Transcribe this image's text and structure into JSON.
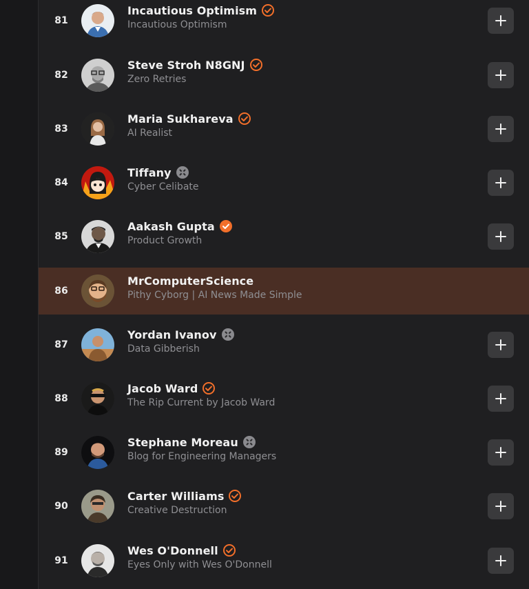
{
  "rows": [
    {
      "rank": "81",
      "name": "Incautious Optimism",
      "subtitle": "Incautious Optimism",
      "badge": "verified-outline",
      "highlighted": false,
      "follow_icon": "plus-icon"
    },
    {
      "rank": "82",
      "name": "Steve Stroh N8GNJ",
      "subtitle": "Zero Retries",
      "badge": "verified-outline",
      "highlighted": false,
      "follow_icon": "plus-icon"
    },
    {
      "rank": "83",
      "name": "Maria Sukhareva",
      "subtitle": "AI Realist",
      "badge": "verified-outline",
      "highlighted": false,
      "follow_icon": "plus-icon"
    },
    {
      "rank": "84",
      "name": "Tiffany",
      "subtitle": "Cyber Celibate",
      "badge": "gray-badge",
      "highlighted": false,
      "follow_icon": "plus-icon"
    },
    {
      "rank": "85",
      "name": "Aakash Gupta",
      "subtitle": "Product Growth",
      "badge": "verified-filled",
      "highlighted": false,
      "follow_icon": "plus-icon"
    },
    {
      "rank": "86",
      "name": "MrComputerScience",
      "subtitle": "Pithy Cyborg | AI News Made Simple",
      "badge": "none",
      "highlighted": true,
      "follow_icon": "none"
    },
    {
      "rank": "87",
      "name": "Yordan Ivanov",
      "subtitle": "Data Gibberish",
      "badge": "gray-badge",
      "highlighted": false,
      "follow_icon": "plus-icon"
    },
    {
      "rank": "88",
      "name": "Jacob Ward",
      "subtitle": "The Rip Current by Jacob Ward",
      "badge": "verified-outline",
      "highlighted": false,
      "follow_icon": "plus-icon"
    },
    {
      "rank": "89",
      "name": "Stephane Moreau",
      "subtitle": "Blog for Engineering Managers",
      "badge": "gray-badge",
      "highlighted": false,
      "follow_icon": "plus-icon"
    },
    {
      "rank": "90",
      "name": "Carter Williams",
      "subtitle": "Creative Destruction",
      "badge": "verified-outline",
      "highlighted": false,
      "follow_icon": "plus-icon"
    },
    {
      "rank": "91",
      "name": "Wes O'Donnell",
      "subtitle": "Eyes Only with Wes O'Donnell",
      "badge": "verified-outline",
      "highlighted": false,
      "follow_icon": "plus-icon"
    }
  ],
  "colors": {
    "background": "#1f1f21",
    "highlight_row": "#4a2e24",
    "accent_orange": "#f26f2a",
    "badge_gray": "#8a8a8e",
    "button_bg": "#3a3a3c"
  }
}
